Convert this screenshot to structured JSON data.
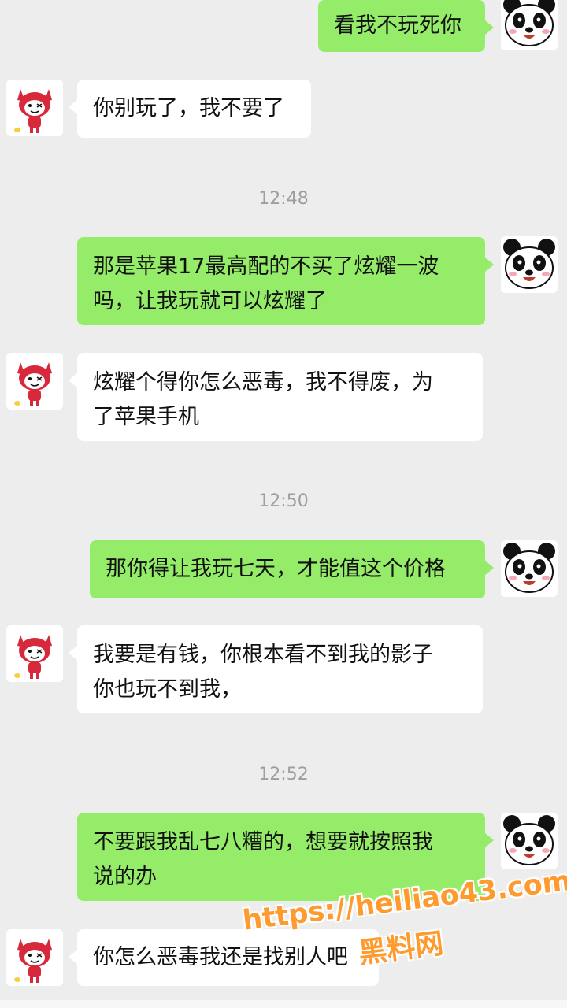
{
  "conversation": {
    "messages": [
      {
        "side": "right",
        "lines": [
          "看我不玩死你"
        ]
      },
      {
        "side": "left",
        "lines": [
          "你别玩了，我不要了"
        ]
      },
      {
        "time": "12:48"
      },
      {
        "side": "right",
        "lines": [
          "那是苹果17最高配的不买了炫耀一波",
          "吗，让我玩就可以炫耀了"
        ]
      },
      {
        "side": "left",
        "lines": [
          "炫耀个得你怎么恶毒，我不得废，为",
          "了苹果手机"
        ]
      },
      {
        "time": "12:50"
      },
      {
        "side": "right",
        "lines": [
          "那你得让我玩七天，才能值这个价格"
        ]
      },
      {
        "side": "left",
        "lines": [
          "我要是有钱，你根本看不到我的影子",
          "你也玩不到我，"
        ]
      },
      {
        "time": "12:52"
      },
      {
        "side": "right",
        "lines": [
          "不要跟我乱七八糟的，想要就按照我",
          "说的办"
        ]
      },
      {
        "side": "left",
        "lines": [
          "你怎么恶毒我还是找别人吧"
        ]
      }
    ]
  },
  "avatars": {
    "self": "panda-avatar-icon",
    "contact": "red-cartoon-fox-avatar-icon"
  },
  "watermark": {
    "url": "https://heiliao43.com",
    "site": "黑料网"
  },
  "colors": {
    "background": "#ededed",
    "sent_bubble": "#95ec69",
    "received_bubble": "#ffffff",
    "timestamp": "#9e9e9e",
    "watermark": "#ff9a2e"
  }
}
